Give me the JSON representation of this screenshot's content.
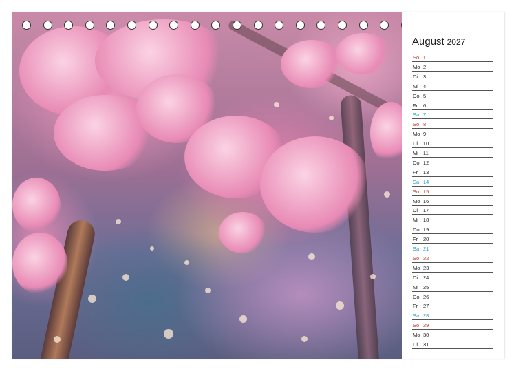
{
  "calendar": {
    "month": "August",
    "year": "2027",
    "days": [
      {
        "wd": "So",
        "d": "1",
        "type": "sun"
      },
      {
        "wd": "Mo",
        "d": "2",
        "type": "weekday"
      },
      {
        "wd": "Di",
        "d": "3",
        "type": "weekday"
      },
      {
        "wd": "Mi",
        "d": "4",
        "type": "weekday"
      },
      {
        "wd": "Do",
        "d": "5",
        "type": "weekday"
      },
      {
        "wd": "Fr",
        "d": "6",
        "type": "weekday"
      },
      {
        "wd": "Sa",
        "d": "7",
        "type": "sat"
      },
      {
        "wd": "So",
        "d": "8",
        "type": "sun"
      },
      {
        "wd": "Mo",
        "d": "9",
        "type": "weekday"
      },
      {
        "wd": "Di",
        "d": "10",
        "type": "weekday"
      },
      {
        "wd": "Mi",
        "d": "11",
        "type": "weekday"
      },
      {
        "wd": "Do",
        "d": "12",
        "type": "weekday"
      },
      {
        "wd": "Fr",
        "d": "13",
        "type": "weekday"
      },
      {
        "wd": "Sa",
        "d": "14",
        "type": "sat"
      },
      {
        "wd": "So",
        "d": "15",
        "type": "sun"
      },
      {
        "wd": "Mo",
        "d": "16",
        "type": "weekday"
      },
      {
        "wd": "Di",
        "d": "17",
        "type": "weekday"
      },
      {
        "wd": "Mi",
        "d": "18",
        "type": "weekday"
      },
      {
        "wd": "Do",
        "d": "19",
        "type": "weekday"
      },
      {
        "wd": "Fr",
        "d": "20",
        "type": "weekday"
      },
      {
        "wd": "Sa",
        "d": "21",
        "type": "sat"
      },
      {
        "wd": "So",
        "d": "22",
        "type": "sun"
      },
      {
        "wd": "Mo",
        "d": "23",
        "type": "weekday"
      },
      {
        "wd": "Di",
        "d": "24",
        "type": "weekday"
      },
      {
        "wd": "Mi",
        "d": "25",
        "type": "weekday"
      },
      {
        "wd": "Do",
        "d": "26",
        "type": "weekday"
      },
      {
        "wd": "Fr",
        "d": "27",
        "type": "weekday"
      },
      {
        "wd": "Sa",
        "d": "28",
        "type": "sat"
      },
      {
        "wd": "So",
        "d": "29",
        "type": "sun"
      },
      {
        "wd": "Mo",
        "d": "30",
        "type": "weekday"
      },
      {
        "wd": "Di",
        "d": "31",
        "type": "weekday"
      }
    ]
  },
  "colors": {
    "saturday": "#2a9bc4",
    "sunday": "#c0392b",
    "weekday": "#222222"
  },
  "binding": {
    "hole_count": 23
  },
  "photo": {
    "subject": "cherry-blossom-tree-photo"
  }
}
